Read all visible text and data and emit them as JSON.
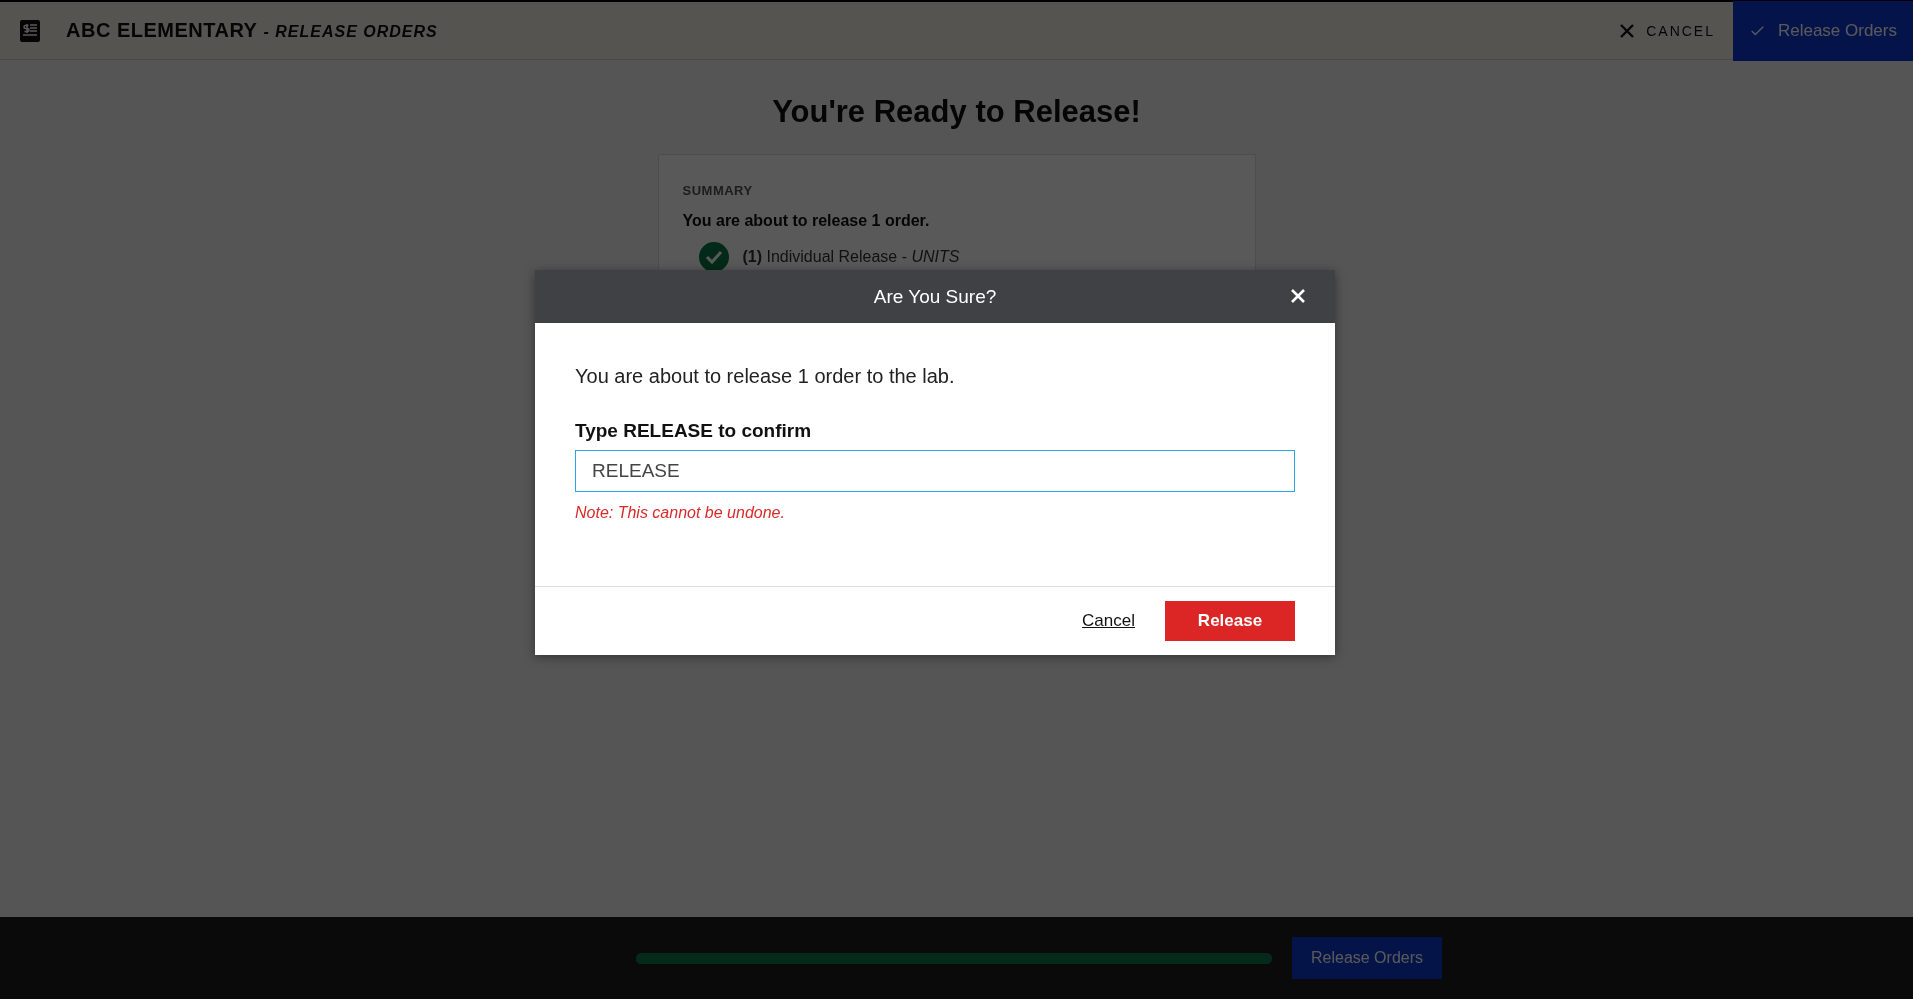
{
  "header": {
    "title": "ABC ELEMENTARY",
    "subtitle": "- RELEASE ORDERS",
    "cancel_label": "CANCEL",
    "release_label": "Release Orders"
  },
  "page": {
    "heading": "You're Ready to Release!",
    "summary": {
      "label": "SUMMARY",
      "text": "You are about to release 1 order.",
      "items": [
        {
          "count": "(1)",
          "name": "Individual Release -",
          "unit": "UNITS",
          "checked": true
        }
      ]
    }
  },
  "dialog": {
    "title": "Are You Sure?",
    "message": "You are about to release 1 order to the lab.",
    "field_label": "Type RELEASE to confirm",
    "field_value": "RELEASE",
    "note": "Note: This cannot be undone.",
    "cancel_label": "Cancel",
    "confirm_label": "Release"
  },
  "footer": {
    "progress": {
      "level": 1.0
    },
    "button_label": "Release Orders"
  }
}
